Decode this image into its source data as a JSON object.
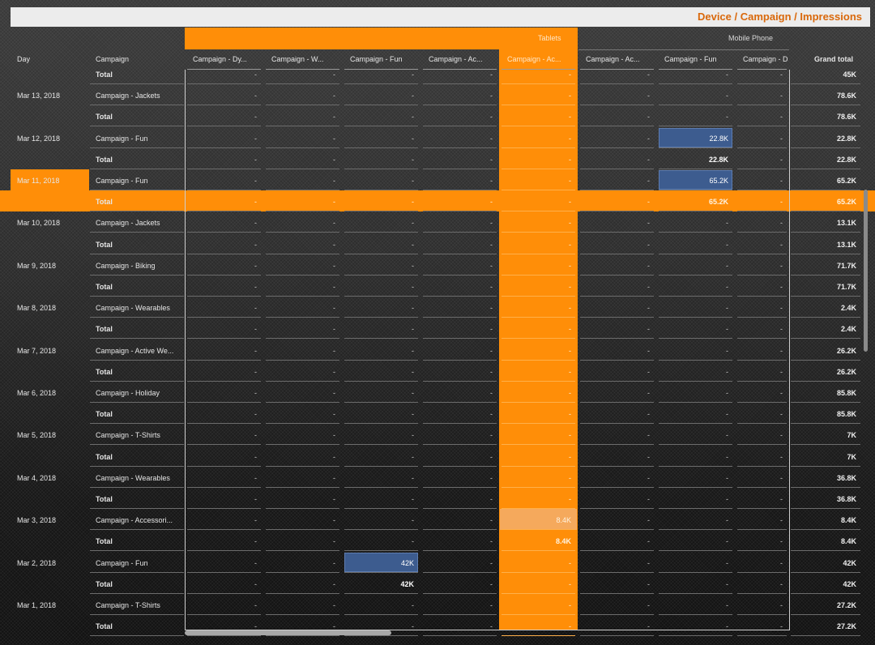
{
  "title": "Device / Campaign / Impressions",
  "devices": {
    "tablets": "Tablets",
    "mobile": "Mobile Phone"
  },
  "headers": {
    "day": "Day",
    "campaign": "Campaign",
    "columns": [
      "Campaign - Dy...",
      "Campaign - W...",
      "Campaign - Fun",
      "Campaign - Ac...",
      "Campaign - Ac...",
      "Campaign - Ac...",
      "Campaign - Fun",
      "Campaign - D"
    ],
    "grand_total": "Grand total"
  },
  "colors": {
    "highlight": "#ff8e08",
    "selected_cell": "#3d5c8f",
    "title": "#d9680b"
  },
  "rows": [
    {
      "day": "",
      "campaign": "Total",
      "total": true,
      "cells": [
        "-",
        "-",
        "-",
        "-",
        "-",
        "-",
        "-",
        "-"
      ],
      "grand": "45K"
    },
    {
      "day": "Mar 13, 2018",
      "campaign": "Campaign - Jackets",
      "total": false,
      "cells": [
        "-",
        "-",
        "-",
        "-",
        "-",
        "-",
        "-",
        "-"
      ],
      "grand": "78.6K"
    },
    {
      "day": "",
      "campaign": "Total",
      "total": true,
      "cells": [
        "-",
        "-",
        "-",
        "-",
        "-",
        "-",
        "-",
        "-"
      ],
      "grand": "78.6K"
    },
    {
      "day": "Mar 12, 2018",
      "campaign": "Campaign - Fun",
      "total": false,
      "cells": [
        "-",
        "-",
        "-",
        "-",
        "-",
        "-",
        "22.8K",
        "-"
      ],
      "grand": "22.8K"
    },
    {
      "day": "",
      "campaign": "Total",
      "total": true,
      "cells": [
        "-",
        "-",
        "-",
        "-",
        "-",
        "-",
        "22.8K",
        "-"
      ],
      "grand": "22.8K"
    },
    {
      "day": "Mar 11, 2018",
      "campaign": "Campaign - Fun",
      "total": false,
      "cells": [
        "-",
        "-",
        "-",
        "-",
        "-",
        "-",
        "65.2K",
        "-"
      ],
      "grand": "65.2K"
    },
    {
      "day": "",
      "campaign": "Total",
      "total": true,
      "cells": [
        "-",
        "-",
        "-",
        "-",
        "-",
        "-",
        "65.2K",
        "-"
      ],
      "grand": "65.2K"
    },
    {
      "day": "Mar 10, 2018",
      "campaign": "Campaign - Jackets",
      "total": false,
      "cells": [
        "-",
        "-",
        "-",
        "-",
        "-",
        "-",
        "-",
        "-"
      ],
      "grand": "13.1K"
    },
    {
      "day": "",
      "campaign": "Total",
      "total": true,
      "cells": [
        "-",
        "-",
        "-",
        "-",
        "-",
        "-",
        "-",
        "-"
      ],
      "grand": "13.1K"
    },
    {
      "day": "Mar 9, 2018",
      "campaign": "Campaign - Biking",
      "total": false,
      "cells": [
        "-",
        "-",
        "-",
        "-",
        "-",
        "-",
        "-",
        "-"
      ],
      "grand": "71.7K"
    },
    {
      "day": "",
      "campaign": "Total",
      "total": true,
      "cells": [
        "-",
        "-",
        "-",
        "-",
        "-",
        "-",
        "-",
        "-"
      ],
      "grand": "71.7K"
    },
    {
      "day": "Mar 8, 2018",
      "campaign": "Campaign - Wearables",
      "total": false,
      "cells": [
        "-",
        "-",
        "-",
        "-",
        "-",
        "-",
        "-",
        "-"
      ],
      "grand": "2.4K"
    },
    {
      "day": "",
      "campaign": "Total",
      "total": true,
      "cells": [
        "-",
        "-",
        "-",
        "-",
        "-",
        "-",
        "-",
        "-"
      ],
      "grand": "2.4K"
    },
    {
      "day": "Mar 7, 2018",
      "campaign": "Campaign - Active We...",
      "total": false,
      "cells": [
        "-",
        "-",
        "-",
        "-",
        "-",
        "-",
        "-",
        "-"
      ],
      "grand": "26.2K"
    },
    {
      "day": "",
      "campaign": "Total",
      "total": true,
      "cells": [
        "-",
        "-",
        "-",
        "-",
        "-",
        "-",
        "-",
        "-"
      ],
      "grand": "26.2K"
    },
    {
      "day": "Mar 6, 2018",
      "campaign": "Campaign - Holiday",
      "total": false,
      "cells": [
        "-",
        "-",
        "-",
        "-",
        "-",
        "-",
        "-",
        "-"
      ],
      "grand": "85.8K"
    },
    {
      "day": "",
      "campaign": "Total",
      "total": true,
      "cells": [
        "-",
        "-",
        "-",
        "-",
        "-",
        "-",
        "-",
        "-"
      ],
      "grand": "85.8K"
    },
    {
      "day": "Mar 5, 2018",
      "campaign": "Campaign - T-Shirts",
      "total": false,
      "cells": [
        "-",
        "-",
        "-",
        "-",
        "-",
        "-",
        "-",
        "-"
      ],
      "grand": "7K"
    },
    {
      "day": "",
      "campaign": "Total",
      "total": true,
      "cells": [
        "-",
        "-",
        "-",
        "-",
        "-",
        "-",
        "-",
        "-"
      ],
      "grand": "7K"
    },
    {
      "day": "Mar 4, 2018",
      "campaign": "Campaign - Wearables",
      "total": false,
      "cells": [
        "-",
        "-",
        "-",
        "-",
        "-",
        "-",
        "-",
        "-"
      ],
      "grand": "36.8K"
    },
    {
      "day": "",
      "campaign": "Total",
      "total": true,
      "cells": [
        "-",
        "-",
        "-",
        "-",
        "-",
        "-",
        "-",
        "-"
      ],
      "grand": "36.8K"
    },
    {
      "day": "Mar 3, 2018",
      "campaign": "Campaign - Accessori...",
      "total": false,
      "cells": [
        "-",
        "-",
        "-",
        "-",
        "8.4K",
        "-",
        "-",
        "-"
      ],
      "grand": "8.4K"
    },
    {
      "day": "",
      "campaign": "Total",
      "total": true,
      "cells": [
        "-",
        "-",
        "-",
        "-",
        "8.4K",
        "-",
        "-",
        "-"
      ],
      "grand": "8.4K"
    },
    {
      "day": "Mar 2, 2018",
      "campaign": "Campaign - Fun",
      "total": false,
      "cells": [
        "-",
        "-",
        "42K",
        "-",
        "-",
        "-",
        "-",
        "-"
      ],
      "grand": "42K"
    },
    {
      "day": "",
      "campaign": "Total",
      "total": true,
      "cells": [
        "-",
        "-",
        "42K",
        "-",
        "-",
        "-",
        "-",
        "-"
      ],
      "grand": "42K"
    },
    {
      "day": "Mar 1, 2018",
      "campaign": "Campaign - T-Shirts",
      "total": false,
      "cells": [
        "-",
        "-",
        "-",
        "-",
        "-",
        "-",
        "-",
        "-"
      ],
      "grand": "27.2K"
    },
    {
      "day": "",
      "campaign": "Total",
      "total": true,
      "cells": [
        "-",
        "-",
        "-",
        "-",
        "-",
        "-",
        "-",
        "-"
      ],
      "grand": "27.2K"
    }
  ]
}
